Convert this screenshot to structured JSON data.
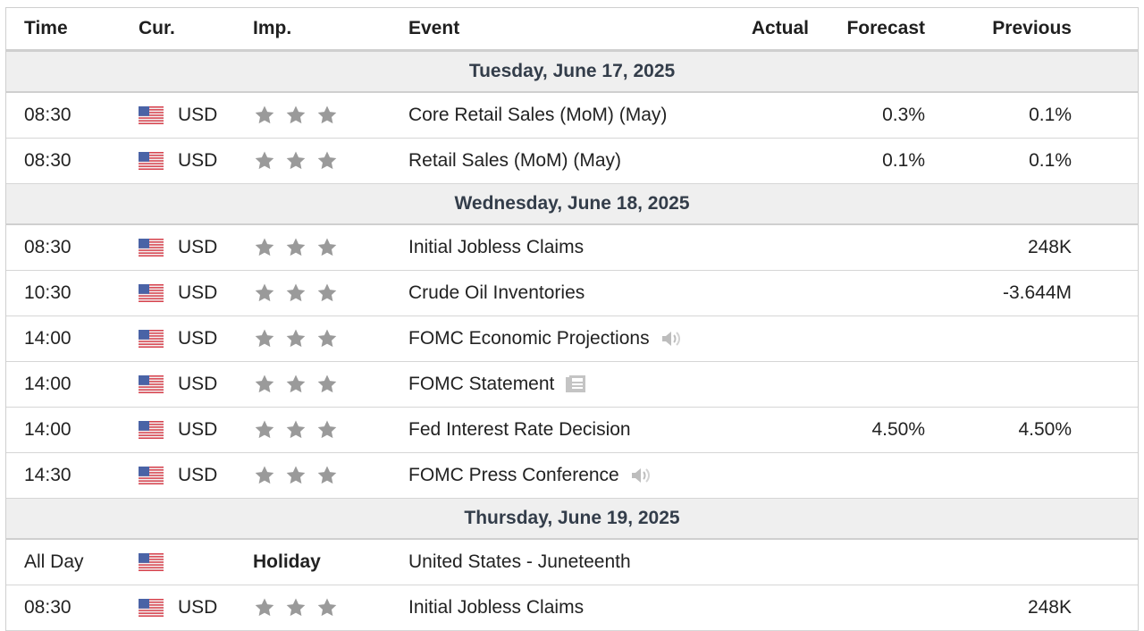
{
  "colors": {
    "star": "#9a9a9a",
    "day_bg": "#efefef",
    "day_text": "#333d4a",
    "border": "#d6d6d6"
  },
  "header": {
    "time": "Time",
    "cur": "Cur.",
    "imp": "Imp.",
    "event": "Event",
    "actual": "Actual",
    "forecast": "Forecast",
    "previous": "Previous"
  },
  "days": [
    {
      "label": "Tuesday, June 17, 2025",
      "events": [
        {
          "time": "08:30",
          "cur": "USD",
          "event": "Core Retail Sales (MoM) (May)",
          "actual": "",
          "forecast": "0.3%",
          "previous": "0.1%"
        },
        {
          "time": "08:30",
          "cur": "USD",
          "event": "Retail Sales (MoM) (May)",
          "actual": "",
          "forecast": "0.1%",
          "previous": "0.1%"
        }
      ]
    },
    {
      "label": "Wednesday, June 18, 2025",
      "events": [
        {
          "time": "08:30",
          "cur": "USD",
          "event": "Initial Jobless Claims",
          "actual": "",
          "forecast": "",
          "previous": "248K"
        },
        {
          "time": "10:30",
          "cur": "USD",
          "event": "Crude Oil Inventories",
          "actual": "",
          "forecast": "",
          "previous": "-3.644M"
        },
        {
          "time": "14:00",
          "cur": "USD",
          "event": "FOMC Economic Projections",
          "icon": "speaker-icon",
          "actual": "",
          "forecast": "",
          "previous": ""
        },
        {
          "time": "14:00",
          "cur": "USD",
          "event": "FOMC Statement",
          "icon": "document-icon",
          "actual": "",
          "forecast": "",
          "previous": ""
        },
        {
          "time": "14:00",
          "cur": "USD",
          "event": "Fed Interest Rate Decision",
          "actual": "",
          "forecast": "4.50%",
          "previous": "4.50%"
        },
        {
          "time": "14:30",
          "cur": "USD",
          "event": "FOMC Press Conference",
          "icon": "speaker-icon",
          "actual": "",
          "forecast": "",
          "previous": ""
        }
      ]
    },
    {
      "label": "Thursday, June 19, 2025",
      "events": [
        {
          "time": "All Day",
          "cur": "",
          "importance": "Holiday",
          "event": "United States - Juneteenth",
          "actual": "",
          "forecast": "",
          "previous": ""
        },
        {
          "time": "08:30",
          "cur": "USD",
          "event": "Initial Jobless Claims",
          "actual": "",
          "forecast": "",
          "previous": "248K"
        }
      ]
    }
  ]
}
